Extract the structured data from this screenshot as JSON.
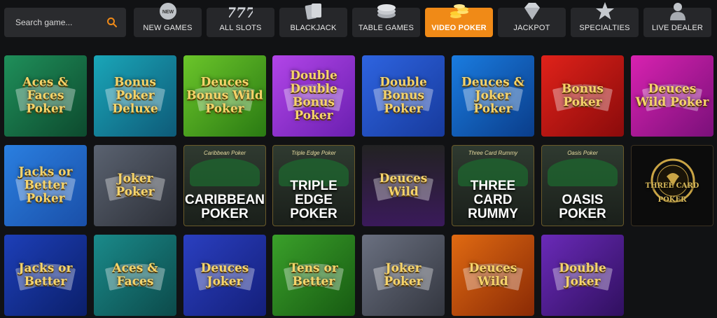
{
  "search": {
    "placeholder": "Search game..."
  },
  "categories": [
    {
      "label": "NEW GAMES",
      "icon": "new-badge-icon"
    },
    {
      "label": "ALL SLOTS",
      "icon": "sevens-icon"
    },
    {
      "label": "BLACKJACK",
      "icon": "cards-icon"
    },
    {
      "label": "TABLE GAMES",
      "icon": "chip-stack-icon"
    },
    {
      "label": "VIDEO POKER",
      "icon": "coins-icon",
      "active": true
    },
    {
      "label": "JACKPOT",
      "icon": "diamond-icon"
    },
    {
      "label": "SPECIALTIES",
      "icon": "star-icon"
    },
    {
      "label": "LIVE DEALER",
      "icon": "dealer-icon"
    }
  ],
  "colors": {
    "accent": "#f08a17",
    "background": "#111214",
    "cat_bg": "#26272a"
  },
  "games": [
    {
      "title": "Aces & Faces Poker",
      "bg": "linear-gradient(135deg,#1f8f5a,#0d4a2e)"
    },
    {
      "title": "Bonus Poker Deluxe",
      "bg": "linear-gradient(135deg,#1aa6b8,#0e5a78)"
    },
    {
      "title": "Deuces Bonus Wild Poker",
      "bg": "linear-gradient(135deg,#6bc52a,#2a7a13)"
    },
    {
      "title": "Double Double Bonus Poker",
      "bg": "linear-gradient(135deg,#b245e8,#6a1fb0)"
    },
    {
      "title": "Double Bonus Poker",
      "bg": "linear-gradient(135deg,#2e64e0,#173a9c)"
    },
    {
      "title": "Deuces & Joker Poker",
      "bg": "linear-gradient(135deg,#1a7ce0,#0a3d8a)"
    },
    {
      "title": "Bonus Poker",
      "bg": "linear-gradient(135deg,#e0221a,#8a0b0b)"
    },
    {
      "title": "Deuces Wild Poker",
      "bg": "linear-gradient(135deg,#d822b0,#7a107a)"
    },
    {
      "title": "Jacks or Better Poker",
      "bg": "linear-gradient(135deg,#2a7fe0,#1a4fa8)"
    },
    {
      "title": "Joker Poker",
      "bg": "linear-gradient(135deg,#5a6270,#2d3038)"
    },
    {
      "title": "CARIBBEAN POKER",
      "sub": "Caribbean Poker",
      "felt": true
    },
    {
      "title": "TRIPLE EDGE POKER",
      "sub": "Triple Edge Poker",
      "felt": true
    },
    {
      "title": "Deuces Wild",
      "bg": "linear-gradient(180deg,#222,#3a1a5a)"
    },
    {
      "title": "THREE CARD RUMMY",
      "sub": "Three Card Rummy",
      "felt": true
    },
    {
      "title": "OASIS POKER",
      "sub": "Oasis Poker",
      "felt": true
    },
    {
      "title": "THREE CARD POKER",
      "logo": true
    },
    {
      "title": "Jacks or Better",
      "bg": "linear-gradient(135deg,#1d3fb8,#0b1f6a)"
    },
    {
      "title": "Aces & Faces",
      "bg": "linear-gradient(135deg,#1a8a8a,#0c4a4a)"
    },
    {
      "title": "Deuces Joker",
      "bg": "linear-gradient(135deg,#2a3fc0,#141f7a)"
    },
    {
      "title": "Tens or Better",
      "bg": "linear-gradient(135deg,#3aa02a,#175a12)"
    },
    {
      "title": "Joker Poker",
      "bg": "linear-gradient(135deg,#6a7080,#33363f)"
    },
    {
      "title": "Deuces Wild",
      "bg": "linear-gradient(135deg,#e06a12,#8a2a05)"
    },
    {
      "title": "Double Joker",
      "bg": "linear-gradient(135deg,#6a2ab8,#30105f)"
    }
  ]
}
